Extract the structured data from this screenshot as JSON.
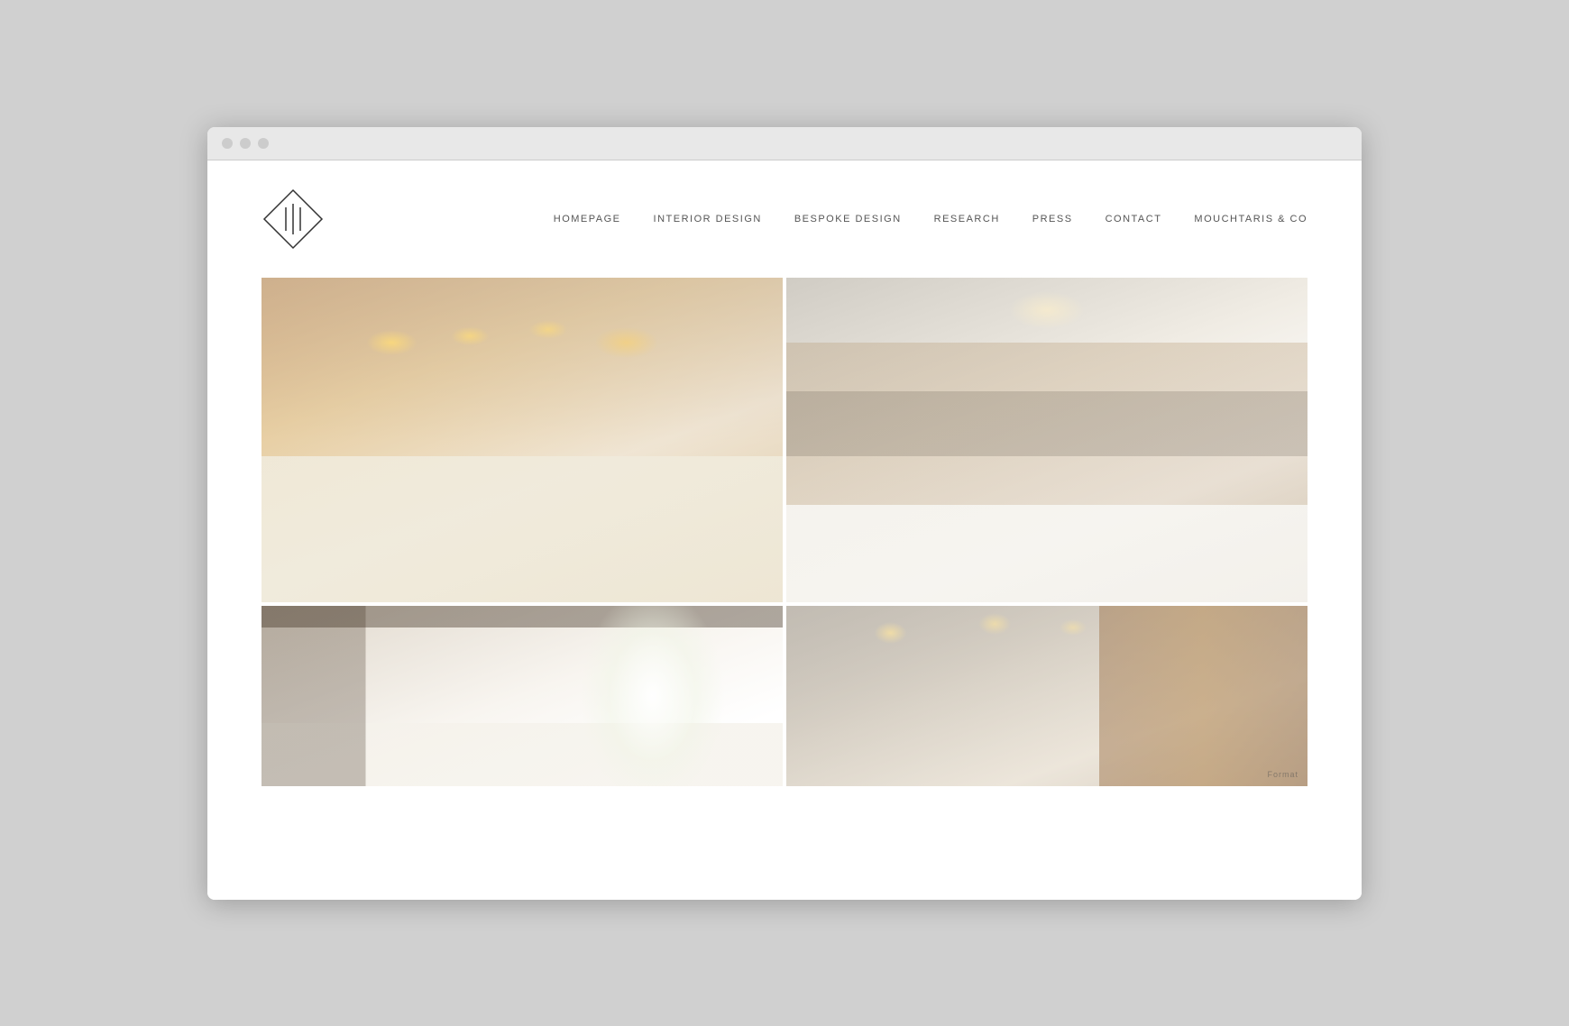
{
  "browser": {
    "dots": [
      "dot1",
      "dot2",
      "dot3"
    ]
  },
  "header": {
    "logo_text": "111",
    "logo_alt": "111 Studio Logo"
  },
  "nav": {
    "items": [
      {
        "id": "homepage",
        "label": "HOMEPAGE"
      },
      {
        "id": "interior-design",
        "label": "INTERIOR DESIGN"
      },
      {
        "id": "bespoke-design",
        "label": "BESPOKE DESIGN"
      },
      {
        "id": "research",
        "label": "RESEARCH"
      },
      {
        "id": "press",
        "label": "PRESS"
      },
      {
        "id": "contact",
        "label": "CONTACT"
      },
      {
        "id": "mouchtaris",
        "label": "MOUCHTARIS & CO"
      }
    ]
  },
  "gallery": {
    "images": [
      {
        "id": "img1",
        "alt": "Interior dining room with warm lighting",
        "position": "top-left"
      },
      {
        "id": "img2",
        "alt": "Modern kitchen and living area",
        "position": "top-right"
      },
      {
        "id": "img3",
        "alt": "Staircase and bright interior",
        "position": "bottom-left"
      },
      {
        "id": "img4",
        "alt": "Glass railing and wood detail",
        "position": "bottom-right"
      }
    ]
  },
  "watermark": {
    "text": "Format"
  }
}
